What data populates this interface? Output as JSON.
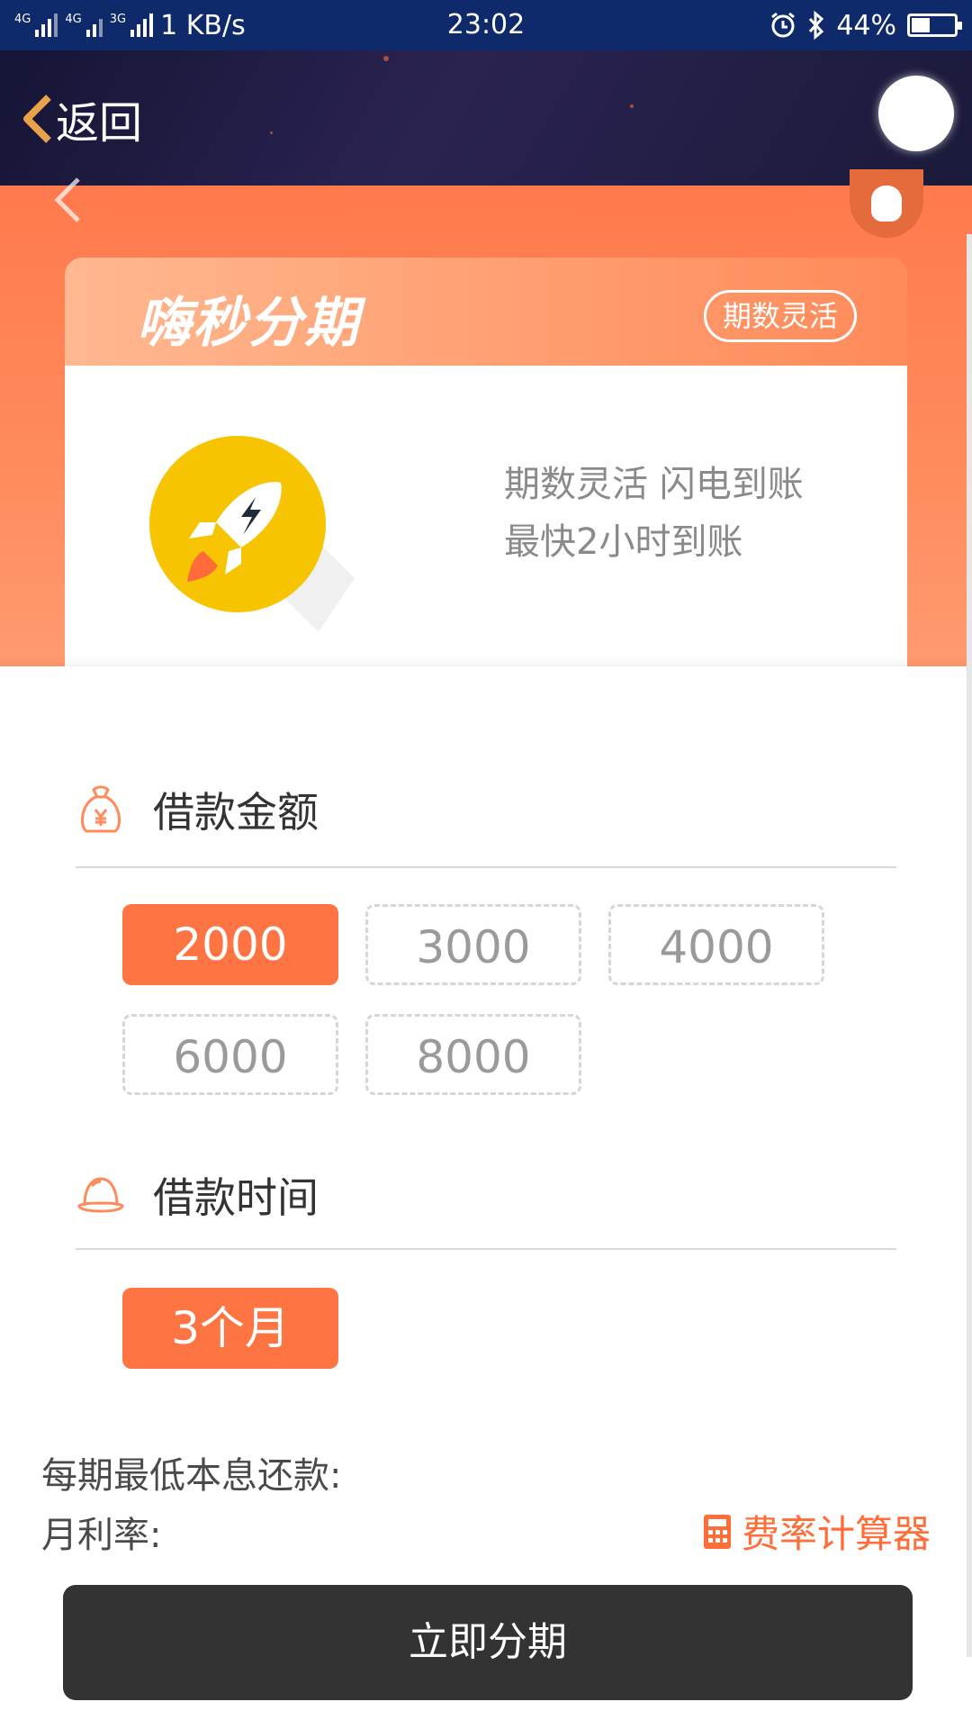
{
  "status_bar": {
    "network_1": "4G",
    "network_2": "4G",
    "network_3": "3G",
    "speed": "1 KB/s",
    "time": "23:02",
    "battery": "44%",
    "battery_level": 0.44
  },
  "header": {
    "back_label": "返回"
  },
  "card": {
    "title": "嗨秒分期",
    "badge": "期数灵活",
    "feature_line_1": "期数灵活 闪电到账",
    "feature_line_2": "最快2小时到账"
  },
  "loan_amount": {
    "label": "借款金额",
    "options": [
      "2000",
      "3000",
      "4000",
      "6000",
      "8000"
    ],
    "selected": "2000"
  },
  "loan_term": {
    "label": "借款时间",
    "options": [
      "3个月"
    ],
    "selected": "3个月"
  },
  "summary": {
    "min_payment_label": "每期最低本息还款:",
    "monthly_rate_label": "月利率:",
    "calculator_label": "费率计算器"
  },
  "submit_label": "立即分期",
  "colors": {
    "accent": "#ff7443",
    "header_bg": "#1a1a3a",
    "status_bar_bg": "#0e2a6b",
    "button_bg": "#333333"
  }
}
